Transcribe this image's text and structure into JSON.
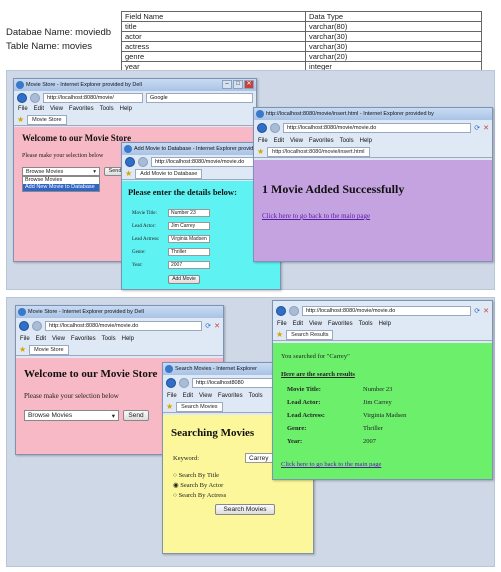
{
  "meta": {
    "db": "Databae Name: moviedb",
    "table": "Table Name: movies"
  },
  "schema": {
    "headers": [
      "Field Name",
      "Data Type"
    ],
    "rows": [
      [
        "title",
        "varchar(80)"
      ],
      [
        "actor",
        "varchar(30)"
      ],
      [
        "actress",
        "varchar(30)"
      ],
      [
        "genre",
        "varchar(20)"
      ],
      [
        "year",
        "integer"
      ]
    ]
  },
  "menu": {
    "file": "File",
    "edit": "Edit",
    "view": "View",
    "fav": "Favorites",
    "tools": "Tools",
    "help": "Help"
  },
  "w1": {
    "title": "Movie Store - Internet Explorer provided by Dell",
    "url": "http://localhost:8080/movie/",
    "search": "Google",
    "tab": "Movie Store",
    "heading": "Welcome to our Movie Store",
    "prompt": "Please make your selection below",
    "selected": "Browse Movies",
    "opt1": "Browse Movies",
    "opt2": "Add New Movie to Database",
    "send": "Send"
  },
  "w2": {
    "title": "Add Movie to Database - Internet Explorer provided by Dell",
    "url": "http://localhost:8080/movie/movie.do",
    "tab": "Add Movie to Database",
    "heading": "Please enter the details below:",
    "l1": "Movie Title:",
    "v1": "Number 23",
    "l2": "Lead Actor:",
    "v2": "Jim Carrey",
    "l3": "Lead Actress:",
    "v3": "Virginia Madsen",
    "l4": "Genre:",
    "v4": "Thriller",
    "l5": "Year:",
    "v5": "2007",
    "btn": "Add Movie"
  },
  "w3": {
    "title": "http://localhost:8080/movie/insert.html - Internet Explorer provided by",
    "url": "http://localhost:8080/movie/movie.do",
    "tab": "http://localhost:8080/movie/insert.html",
    "heading": "1 Movie Added Successfully",
    "link": "Click here to go back to the main page"
  },
  "w4": {
    "title": "Movie Store - Internet Explorer provided by Dell",
    "url": "http://localhost:8080/movie/movie.do",
    "tab": "Movie Store",
    "heading": "Welcome to our Movie Store",
    "prompt": "Please make your selection below",
    "selected": "Browse Movies",
    "send": "Send"
  },
  "w5": {
    "title": "Search Movies - Internet Explorer",
    "url": "http://localhost8080",
    "tab": "Search Movies",
    "heading": "Searching Movies",
    "kw_label": "Keyword:",
    "kw_value": "Carrey",
    "r1": "Search By Title",
    "r2": "Search By Actor",
    "r3": "Search By Actress",
    "btn": "Search Movies"
  },
  "w6": {
    "url": "http://localhost:8080/movie/movie.do",
    "tab": "Search Results",
    "intro": "You searched for \"Carrey\"",
    "heading": "Here are the search results",
    "l1": "Movie Title:",
    "v1": "Number 23",
    "l2": "Lead Actor:",
    "v2": "Jim Carrey",
    "l3": "Lead Actress:",
    "v3": "Virginia Madsen",
    "l4": "Genre:",
    "v4": "Thriller",
    "l5": "Year:",
    "v5": "2007",
    "link": "Click here to go back to the main page"
  }
}
